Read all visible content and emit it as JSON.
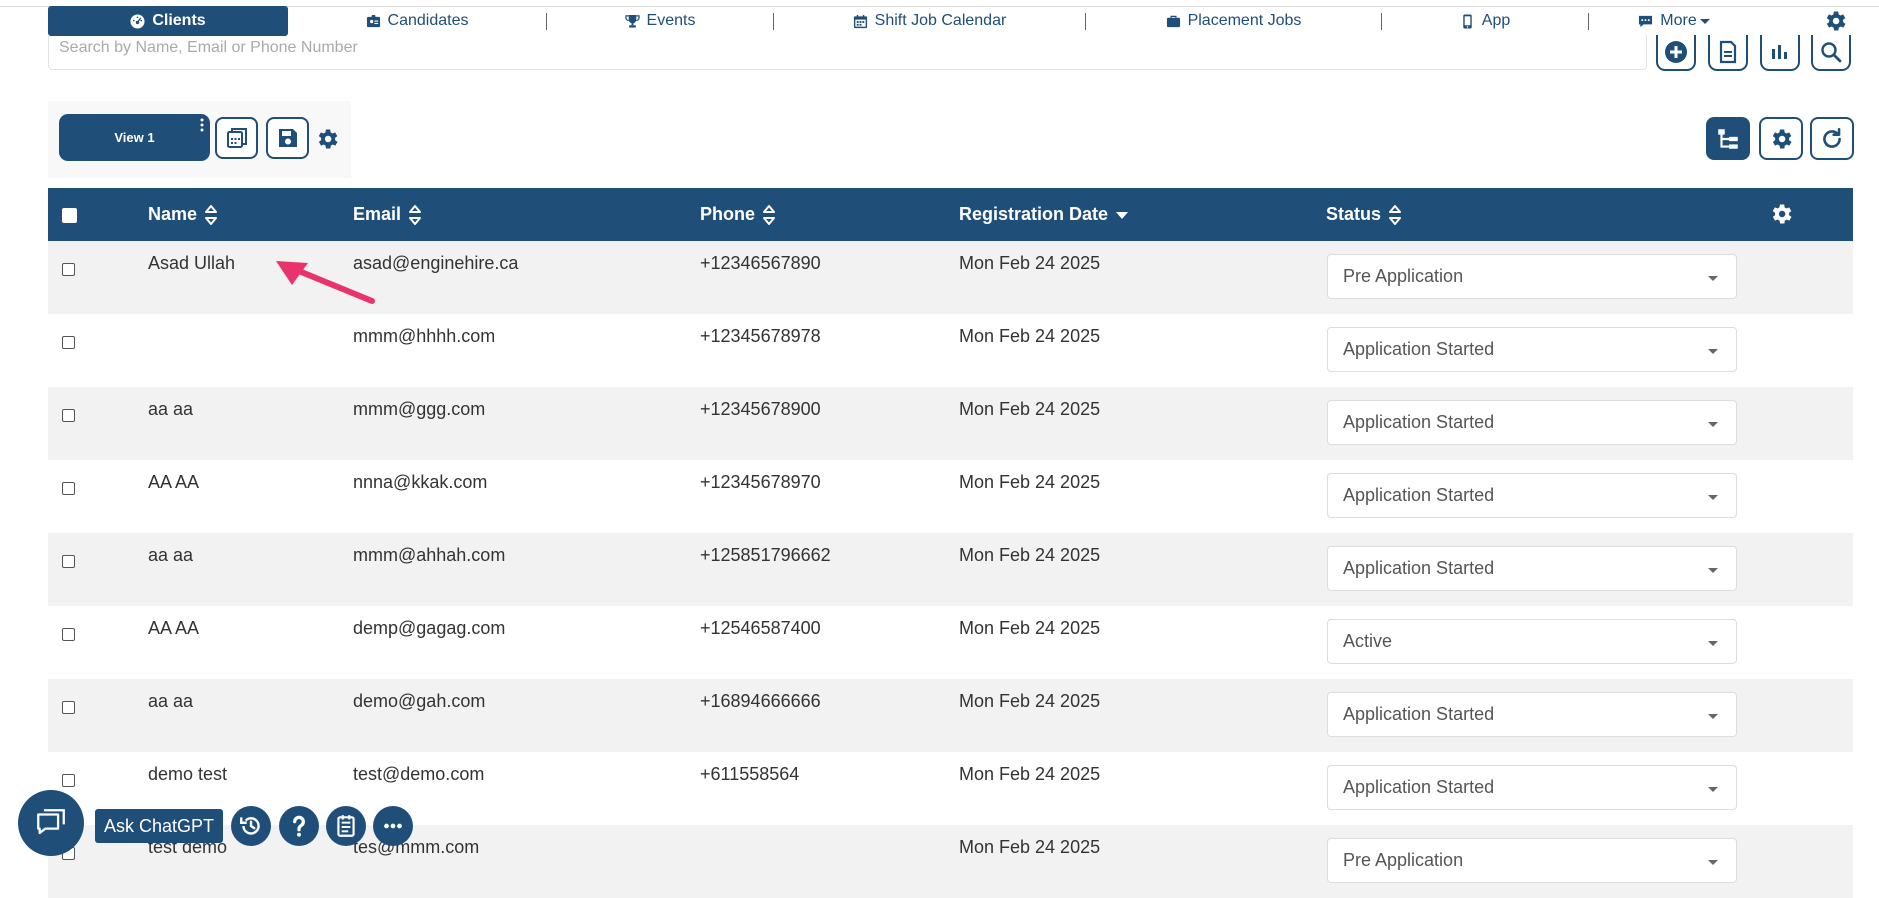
{
  "nav": {
    "items": [
      {
        "label": "Clients",
        "icon": "tachometer-icon",
        "active": true
      },
      {
        "label": "Candidates",
        "icon": "id-badge-icon"
      },
      {
        "label": "Events",
        "icon": "trophy-icon"
      },
      {
        "label": "Shift Job Calendar",
        "icon": "calendar-icon"
      },
      {
        "label": "Placement Jobs",
        "icon": "briefcase-icon"
      },
      {
        "label": "App",
        "icon": "mobile-icon"
      },
      {
        "label": "More",
        "icon": "chat-bubble-icon"
      }
    ],
    "settings_icon": "gear-icon"
  },
  "search": {
    "placeholder": "Search by Name, Email or Phone Number"
  },
  "toolbar": {
    "icons": [
      "plus-circle-icon",
      "document-icon",
      "bar-chart-icon",
      "search-icon"
    ]
  },
  "views": {
    "tab_label": "View 1",
    "buttons": [
      "copy-view-icon",
      "save-icon",
      "gear-icon"
    ],
    "right_buttons": [
      "hierarchy-icon",
      "gear-icon",
      "refresh-icon"
    ]
  },
  "table": {
    "headers": {
      "name": "Name",
      "email": "Email",
      "phone": "Phone",
      "registration_date": "Registration Date",
      "status": "Status"
    },
    "sort": {
      "column": "registration_date",
      "direction": "desc"
    },
    "rows": [
      {
        "name": "Asad Ullah",
        "email": "asad@enginehire.ca",
        "phone": "+12346567890",
        "date": "Mon Feb 24 2025",
        "status": "Pre Application"
      },
      {
        "name": "",
        "email": "mmm@hhhh.com",
        "phone": "+12345678978",
        "date": "Mon Feb 24 2025",
        "status": "Application Started"
      },
      {
        "name": "aa aa",
        "email": "mmm@ggg.com",
        "phone": "+12345678900",
        "date": "Mon Feb 24 2025",
        "status": "Application Started"
      },
      {
        "name": "AA AA",
        "email": "nnna@kkak.com",
        "phone": "+12345678970",
        "date": "Mon Feb 24 2025",
        "status": "Application Started"
      },
      {
        "name": "aa aa",
        "email": "mmm@ahhah.com",
        "phone": "+125851796662",
        "date": "Mon Feb 24 2025",
        "status": "Application Started"
      },
      {
        "name": "AA AA",
        "email": "demp@gagag.com",
        "phone": "+12546587400",
        "date": "Mon Feb 24 2025",
        "status": "Active"
      },
      {
        "name": "aa aa",
        "email": "demo@gah.com",
        "phone": "+16894666666",
        "date": "Mon Feb 24 2025",
        "status": "Application Started"
      },
      {
        "name": "demo test",
        "email": "test@demo.com",
        "phone": "+611558564",
        "date": "Mon Feb 24 2025",
        "status": "Application Started"
      },
      {
        "name": "test demo",
        "email": "tes@mmm.com",
        "phone": "",
        "date": "Mon Feb 24 2025",
        "status": "Pre Application"
      }
    ]
  },
  "bottom_bar": {
    "ask_label": "Ask ChatGPT",
    "icons": [
      "chat-icon",
      "history-icon",
      "help-icon",
      "notes-icon",
      "more-icon"
    ]
  },
  "colors": {
    "primary": "#1f4e79",
    "annotation_arrow": "#e8336b",
    "row_alt": "#f2f2f2"
  }
}
